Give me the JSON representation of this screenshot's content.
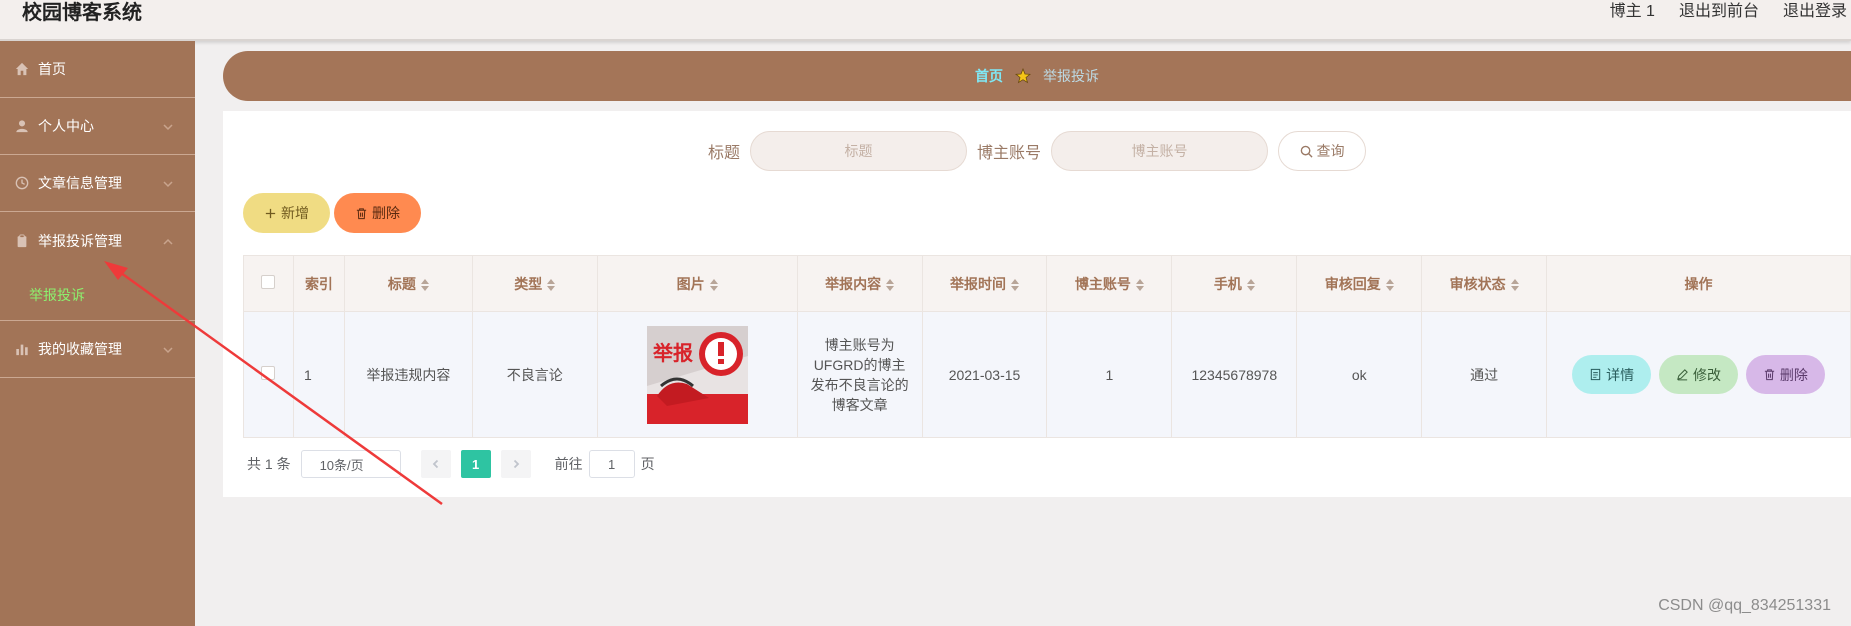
{
  "header": {
    "app_title": "校园博客系统",
    "user_label": "博主 1",
    "to_front_label": "退出到前台",
    "logout_label": "退出登录"
  },
  "sidebar": {
    "items": [
      {
        "label": "首页",
        "icon": "home-icon"
      },
      {
        "label": "个人中心",
        "icon": "user-icon"
      },
      {
        "label": "文章信息管理",
        "icon": "clock-icon"
      },
      {
        "label": "举报投诉管理",
        "icon": "clipboard-icon"
      },
      {
        "label": "举报投诉",
        "icon": ""
      },
      {
        "label": "我的收藏管理",
        "icon": "bar-chart-icon"
      }
    ],
    "active_sub_color": "#8cf06e"
  },
  "breadcrumb": {
    "home": "首页",
    "current": "举报投诉"
  },
  "search": {
    "title_label": "标题",
    "title_placeholder": "标题",
    "account_label": "博主账号",
    "account_placeholder": "博主账号",
    "query_label": "查询"
  },
  "actions": {
    "add_label": "新增",
    "delete_label": "删除"
  },
  "table": {
    "headers": [
      "索引",
      "标题",
      "类型",
      "图片",
      "举报内容",
      "举报时间",
      "博主账号",
      "手机",
      "审核回复",
      "审核状态",
      "操作"
    ],
    "rows": [
      {
        "index": "1",
        "title": "举报违规内容",
        "type": "不良言论",
        "image_text": "举报",
        "content": "博主账号为UFGRD的博主发布不良言论的博客文章",
        "time": "2021-03-15",
        "account": "1",
        "phone": "12345678978",
        "reply": "ok",
        "status": "通过",
        "op_detail": "详情",
        "op_edit": "修改",
        "op_delete": "删除"
      }
    ]
  },
  "pager": {
    "total": "共 1 条",
    "page_size": "10条/页",
    "current_page": "1",
    "goto_prefix": "前往",
    "goto_value": "1",
    "goto_suffix": "页"
  },
  "watermark": "CSDN @qq_834251331",
  "colors": {
    "sidebar": "#a27457",
    "accent_brown": "#a47558",
    "pager_active": "#2ec4a2"
  }
}
